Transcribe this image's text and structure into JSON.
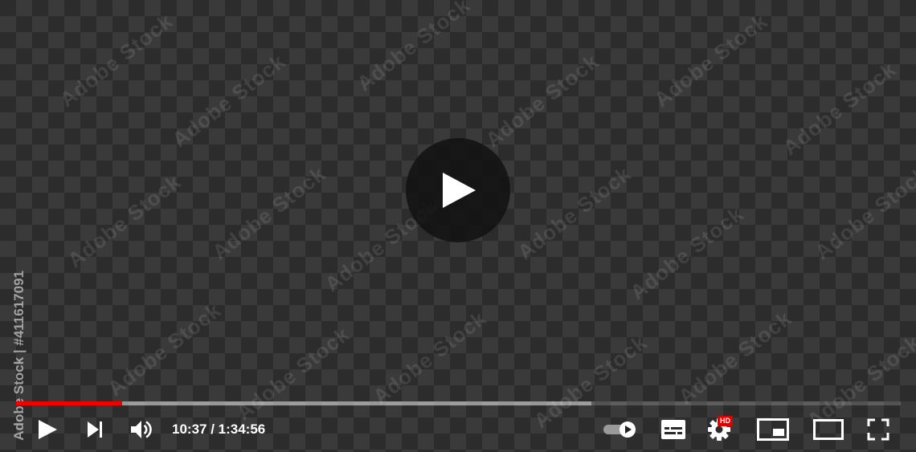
{
  "watermark": {
    "text": "Adobe Stock",
    "side_id": "Adobe Stock | #411617091"
  },
  "player": {
    "current_time": "10:37",
    "separator": " / ",
    "duration": "1:34:56",
    "progress_played_fraction": 0.12,
    "progress_buffered_fraction": 0.65,
    "hd_badge": "HD",
    "autoplay_on": true
  },
  "colors": {
    "progress_played": "#f20000",
    "hd_badge": "#e00000",
    "icon": "#ffffff"
  },
  "icons": {
    "big_play": "play-icon",
    "play": "play-icon",
    "next": "skip-next-icon",
    "volume": "volume-icon",
    "autoplay": "autoplay-toggle-icon",
    "subtitles": "subtitles-icon",
    "settings": "gear-icon",
    "miniplayer": "miniplayer-icon",
    "theater": "theater-mode-icon",
    "fullscreen": "fullscreen-icon"
  }
}
